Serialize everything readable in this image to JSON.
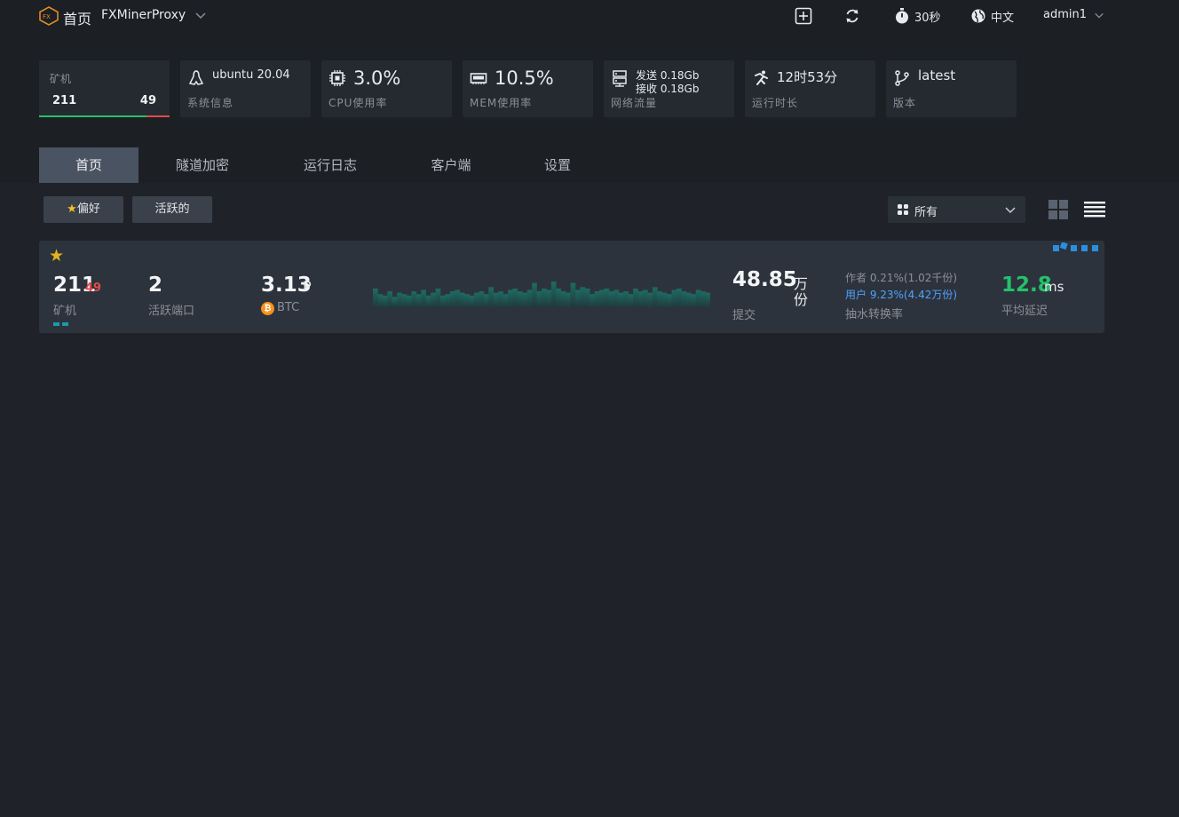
{
  "header": {
    "home_title": "首页",
    "app_name": "FXMinerProxy",
    "refresh_interval": "30秒",
    "language": "中文",
    "user": "admin1"
  },
  "stats": {
    "miners": {
      "label": "矿机",
      "online": "211",
      "offline": "49"
    },
    "system": {
      "value": "ubuntu 20.04",
      "label": "系统信息"
    },
    "cpu": {
      "value": "3.0%",
      "label": "CPU使用率"
    },
    "mem": {
      "value": "10.5%",
      "label": "MEM使用率"
    },
    "network": {
      "send": "发送 0.18Gb",
      "recv": "接收 0.18Gb",
      "label": "网络流量"
    },
    "uptime": {
      "value": "12时53分",
      "label": "运行时长"
    },
    "version": {
      "value": "latest",
      "label": "版本"
    }
  },
  "tabs": [
    {
      "label": "首页",
      "active": true
    },
    {
      "label": "隧道加密",
      "active": false
    },
    {
      "label": "运行日志",
      "active": false
    },
    {
      "label": "客户端",
      "active": false
    },
    {
      "label": "设置",
      "active": false
    }
  ],
  "filters": {
    "favorite": "偏好",
    "active": "活跃的",
    "select_value": "所有"
  },
  "pool_card": {
    "miners_online": "211",
    "miners_offline": "49",
    "miners_label": "矿机",
    "ports": "2",
    "ports_label": "活跃端口",
    "hashrate": "3.13",
    "hashrate_unit": "P",
    "coin": "BTC",
    "shares": "48.85",
    "shares_unit_1": "万",
    "shares_unit_2": "份",
    "shares_label": "提交",
    "fee_author": "作者 0.21%(1.02千份)",
    "fee_user": "用户 9.23%(4.42万份)",
    "fee_label": "抽水转换率",
    "latency": "12.8",
    "latency_unit": "ms",
    "latency_label": "平均延迟",
    "sparkline": [
      14,
      10,
      9,
      12,
      8,
      11,
      10,
      9,
      12,
      10,
      13,
      9,
      11,
      14,
      9,
      10,
      12,
      13,
      11,
      10,
      9,
      11,
      12,
      10,
      15,
      11,
      12,
      10,
      13,
      14,
      12,
      11,
      13,
      18,
      12,
      14,
      13,
      19,
      14,
      12,
      11,
      18,
      13,
      15,
      14,
      10,
      12,
      13,
      14,
      12,
      13,
      11,
      12,
      10,
      14,
      12,
      13,
      11,
      15,
      12,
      11,
      10,
      13,
      14,
      12,
      11,
      10,
      13,
      12,
      11
    ]
  },
  "colors": {
    "accent_green": "#23c26b",
    "accent_red": "#e14b4b",
    "accent_blue": "#4da3ff",
    "sparkline": "#1d6b63",
    "btc": "#f7931a"
  }
}
